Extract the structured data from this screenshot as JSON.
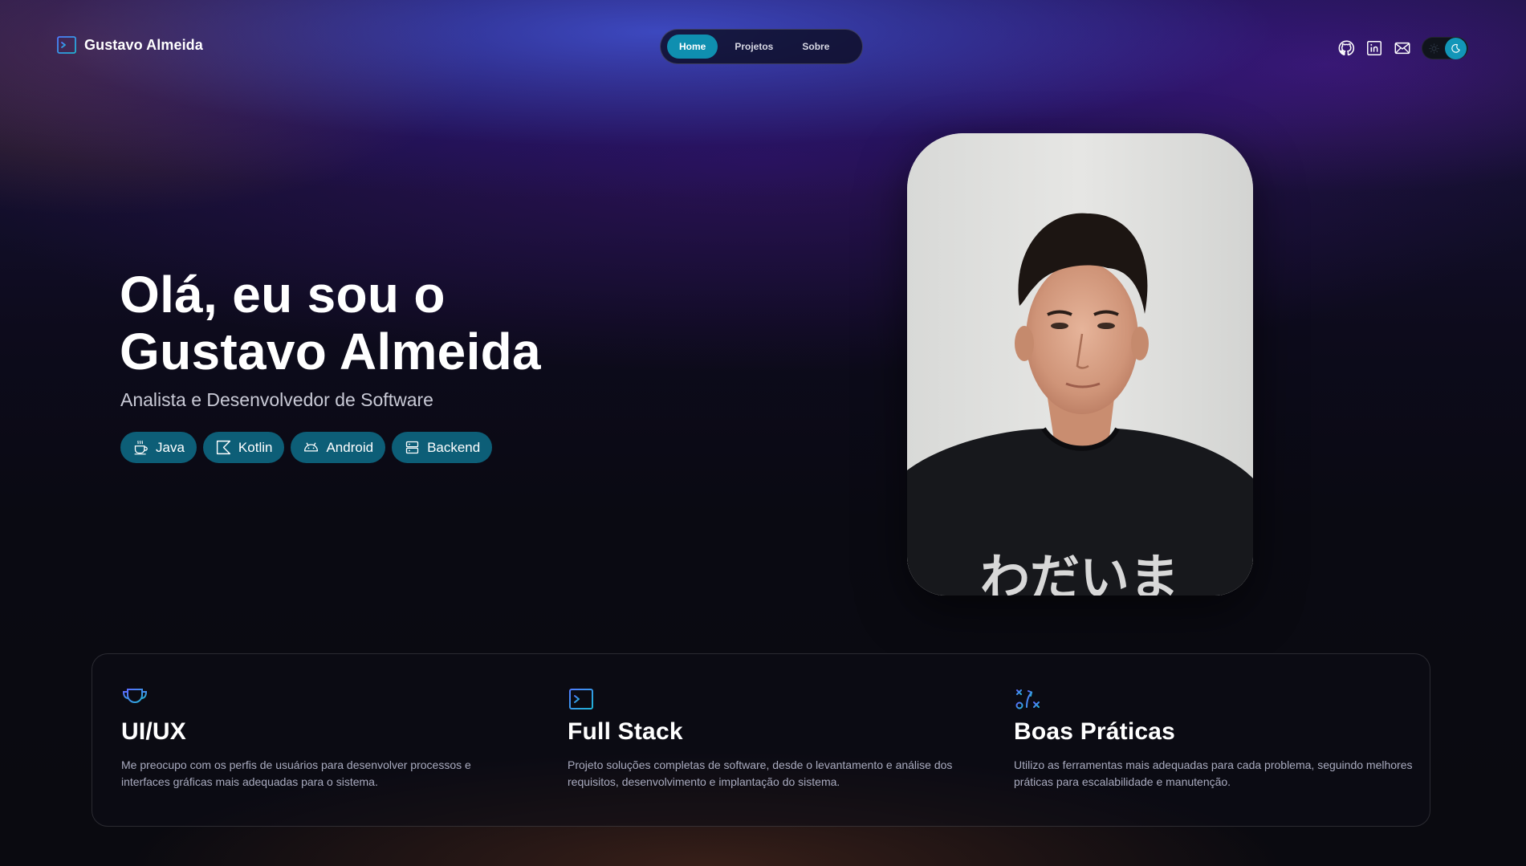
{
  "header": {
    "brand_name": "Gustavo Almeida",
    "brand_icon": "terminal-icon",
    "nav": [
      {
        "label": "Home",
        "active": true
      },
      {
        "label": "Projetos",
        "active": false
      },
      {
        "label": "Sobre",
        "active": false
      }
    ],
    "social_icons": [
      "github-icon",
      "linkedin-icon",
      "mail-icon"
    ],
    "theme_toggle": {
      "state": "dark",
      "icons": [
        "sun-icon",
        "moon-icon"
      ]
    }
  },
  "hero": {
    "title_line1": "Olá, eu sou o",
    "title_line2": "Gustavo Almeida",
    "subtitle": "Analista e Desenvolvedor de Software",
    "chips": [
      {
        "label": "Java",
        "icon": "coffee-icon"
      },
      {
        "label": "Kotlin",
        "icon": "kotlin-icon"
      },
      {
        "label": "Android",
        "icon": "android-icon"
      },
      {
        "label": "Backend",
        "icon": "server-icon"
      }
    ],
    "photo_text": "わだいま"
  },
  "features": [
    {
      "icon": "trophy-icon",
      "title": "UI/UX",
      "description": "Me preocupo com os perfis de usuários para desenvolver processos e interfaces gráficas mais adequadas para o sistema."
    },
    {
      "icon": "terminal-icon",
      "title": "Full Stack",
      "description": "Projeto soluções completas de software, desde o levantamento e análise dos requisitos, desenvolvimento e implantação do sistema."
    },
    {
      "icon": "strategy-icon",
      "title": "Boas Práticas",
      "description": "Utilizo as ferramentas mais adequadas para cada problema, seguindo melhores práticas para escalabilidade e manutenção."
    }
  ],
  "colors": {
    "accent": "#0f8fb0",
    "chip_bg": "#0d5e77",
    "feature_icon": "#3aa9d8",
    "text_muted": "#a9abbf"
  }
}
